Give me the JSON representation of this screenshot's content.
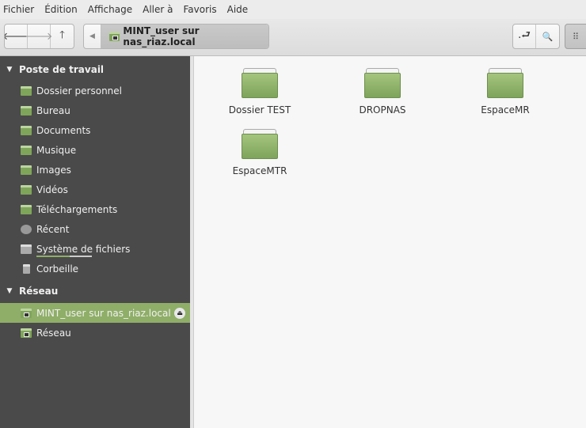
{
  "menu": [
    "Fichier",
    "Édition",
    "Affichage",
    "Aller à",
    "Favoris",
    "Aide"
  ],
  "toolbar": {
    "back": "🡐",
    "forward": "🡒",
    "up": "🡑",
    "path_lead": "◀",
    "location": "MINT_user sur nas_riaz.local",
    "toggle_location": ".⮐",
    "search": "🔍",
    "view": "⠿"
  },
  "sidebar": {
    "sections": [
      {
        "title": "Poste de travail",
        "items": [
          "Dossier personnel",
          "Bureau",
          "Documents",
          "Musique",
          "Images",
          "Vidéos",
          "Téléchargements",
          "Récent",
          "Système de fichiers",
          "Corbeille"
        ]
      },
      {
        "title": "Réseau",
        "items": [
          "MINT_user sur nas_riaz.local",
          "Réseau"
        ]
      }
    ],
    "selected": "MINT_user sur nas_riaz.local",
    "disk_usage_fraction": 0.6
  },
  "files": [
    "Dossier TEST",
    "DROPNAS",
    "EspaceMR",
    "EspaceMTR"
  ],
  "colors": {
    "accent": "#8fae68",
    "sidebar_bg": "#4a4a4a"
  }
}
